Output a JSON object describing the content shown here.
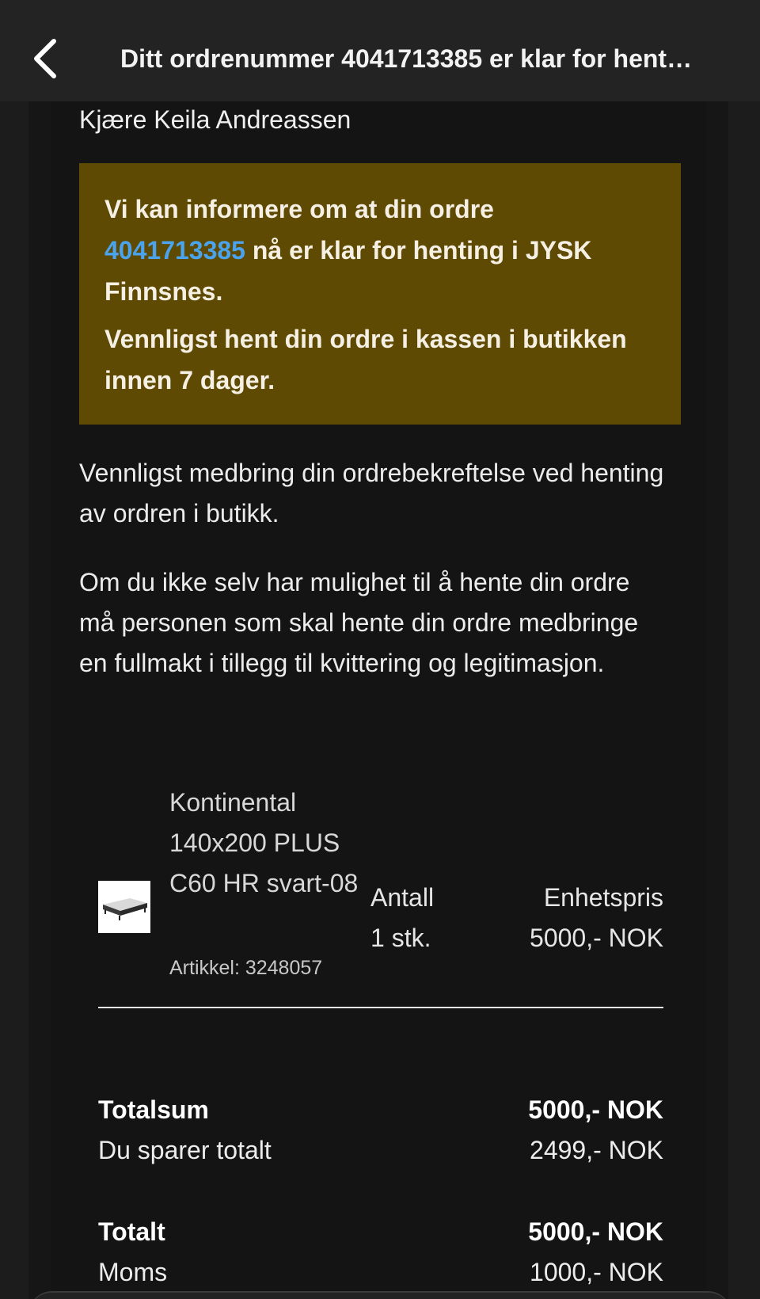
{
  "header": {
    "title": "Ditt ordrenummer 4041713385 er klar for hent…"
  },
  "greeting": "Kjære Keila Andreassen",
  "notice": {
    "line1_prefix": "Vi kan informere om at din ordre",
    "order_number": "4041713385",
    "line1_suffix": " nå er klar for henting i JYSK Finnsnes.",
    "line2": "Vennligst hent din ordre i kassen i butikken innen 7 dager.",
    "background_color": "#5f4a04",
    "link_color": "#4aa3ec"
  },
  "paragraphs": {
    "p1": "Vennligst medbring din ordrebekreftelse ved henting av ordren i butikk.",
    "p2": "Om du ikke selv har mulighet til å hente din ordre må personen som skal hente din ordre medbringe en fullmakt i tillegg til kvittering og legitimasjon."
  },
  "item": {
    "name": "Kontinental 140x200 PLUS C60 HR svart-08",
    "sku": "Artikkel: 3248057",
    "qty_label": "Antall",
    "qty_value": "1 stk.",
    "price_label": "Enhetspris",
    "price_value": "5000,- NOK",
    "image_icon": "bed-product-image"
  },
  "summary": {
    "totalsum_label": "Totalsum",
    "totalsum_value": "5000,- NOK",
    "savings_label": "Du sparer totalt",
    "savings_value": "2499,- NOK",
    "total_label": "Totalt",
    "total_value": "5000,- NOK",
    "vat_label": "Moms",
    "vat_value": "1000,- NOK"
  }
}
